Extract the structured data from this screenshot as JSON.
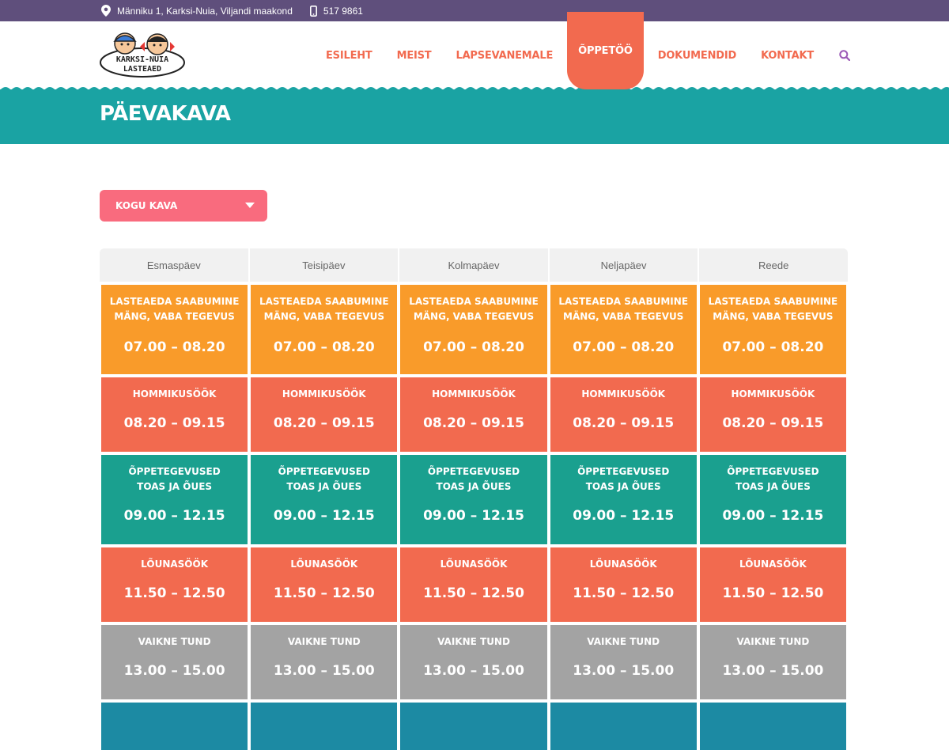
{
  "topbar": {
    "address": "Männiku 1, Karksi-Nuia, Viljandi maakond",
    "phone": "517 9861"
  },
  "logo": {
    "line1": "KARKSI-NUIA",
    "line2": "LASTEAED"
  },
  "nav": {
    "items": [
      "ESILEHT",
      "MEIST",
      "LAPSEVANEMALE",
      "ÕPPETÖÖ",
      "DOKUMENDID",
      "KONTAKT"
    ],
    "active": "ÕPPETÖÖ"
  },
  "page_title": "PÄEVAKAVA",
  "filter": {
    "selected": "KOGU KAVA"
  },
  "schedule": {
    "days": [
      "Esmaspäev",
      "Teisipäev",
      "Kolmapäev",
      "Neljapäev",
      "Reede"
    ],
    "rows": [
      {
        "label": "LASTEAEDA SAABUMINE\nMÄNG, VABA TEGEVUS",
        "time": "07.00 – 08.20",
        "color": "#f99b2a"
      },
      {
        "label": "HOMMIKUSÖÖK",
        "time": "08.20 – 09.15",
        "color": "#f26a4f"
      },
      {
        "label": "ÕPPETEGEVUSED\nTOAS JA ÕUES",
        "time": "09.00 – 12.15",
        "color": "#1aa08f"
      },
      {
        "label": "LÕUNASÖÖK",
        "time": "11.50 – 12.50",
        "color": "#f26a4f"
      },
      {
        "label": "VAIKNE TUND",
        "time": "13.00 – 15.00",
        "color": "#a3a3a3"
      },
      {
        "label": "",
        "time": "",
        "color": "#1c8aa3"
      }
    ]
  },
  "colors": {
    "topbar": "#5f4f7c",
    "accent": "#f26a4f",
    "band": "#1aa3a3",
    "dropdown": "#f96b7e",
    "search_icon": "#9b59b6"
  }
}
